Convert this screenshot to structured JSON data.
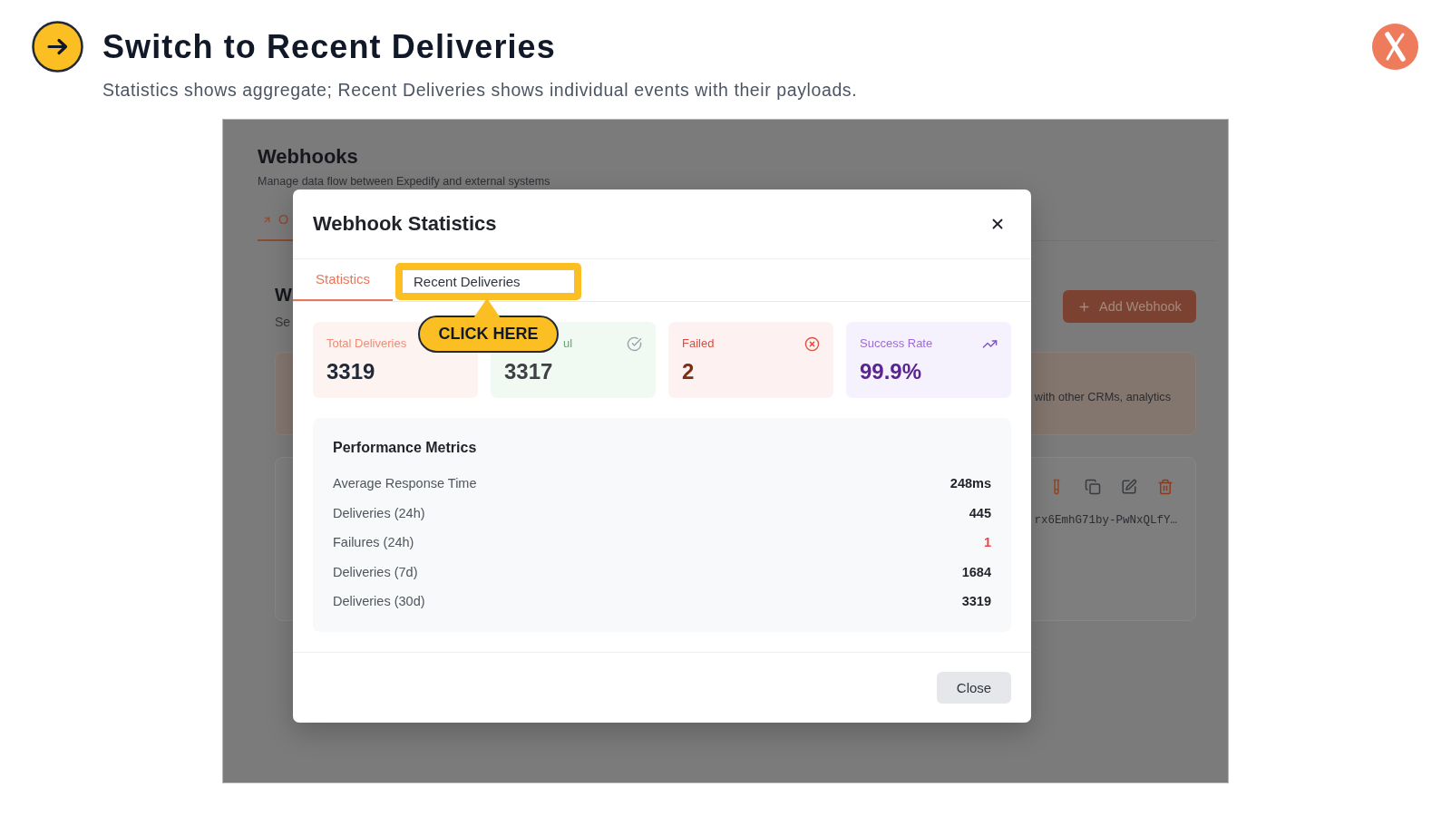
{
  "header": {
    "title": "Switch to Recent Deliveries",
    "subtitle": "Statistics shows aggregate; Recent Deliveries shows individual events with their payloads."
  },
  "background_page": {
    "title": "Webhooks",
    "subtitle": "Manage data flow between Expedify and external systems",
    "tab": "O",
    "section_title": "W",
    "section_subtitle": "Se",
    "add_button": "Add Webhook",
    "info_card_text": "with other CRMs, analytics",
    "webhook_secret": "rx6EmhG71by-PwNxQLfY…"
  },
  "modal": {
    "title": "Webhook Statistics",
    "tabs": [
      {
        "label": "Statistics",
        "selected": true,
        "highlighted": false
      },
      {
        "label": "Recent Deliveries",
        "selected": false,
        "highlighted": true
      }
    ],
    "callout": "CLICK HERE",
    "stat_cards": [
      {
        "kind": "total",
        "label": "Total Deliveries",
        "value": "3319"
      },
      {
        "kind": "success",
        "label": "ul",
        "value": "3317"
      },
      {
        "kind": "failed",
        "label": "Failed",
        "value": "2"
      },
      {
        "kind": "rate",
        "label": "Success Rate",
        "value": "99.9%"
      }
    ],
    "metrics": {
      "title": "Performance Metrics",
      "rows": [
        {
          "label": "Average Response Time",
          "value": "248ms",
          "kind": "plain"
        },
        {
          "label": "Deliveries (24h)",
          "value": "445",
          "kind": "plain"
        },
        {
          "label": "Failures (24h)",
          "value": "1",
          "kind": "alert"
        },
        {
          "label": "Deliveries (7d)",
          "value": "1684",
          "kind": "plain"
        },
        {
          "label": "Deliveries (30d)",
          "value": "3319",
          "kind": "plain"
        }
      ]
    },
    "close_button": "Close"
  }
}
